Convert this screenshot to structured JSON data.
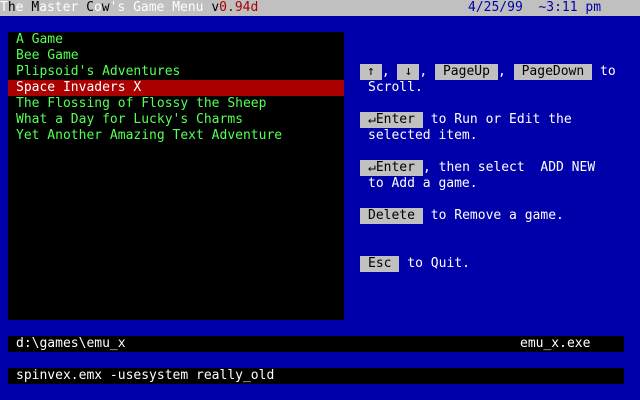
{
  "titlebar": {
    "title_parts": [
      "T",
      "h",
      "e ",
      "M",
      "aster ",
      "C",
      "o",
      "w",
      "'s Game Menu ",
      "v",
      "0.94d"
    ],
    "datetime": "4/25/99  ~3:11 pm"
  },
  "game_list": {
    "items": [
      "A Game",
      "Bee Game",
      "Plipsoid's Adventures",
      "Space Invaders X",
      "The Flossing of Flossy the Sheep",
      "What a Day for Lucky's Charms",
      "Yet Another Amazing Text Adventure"
    ],
    "selected_index": 3
  },
  "help": {
    "scroll": {
      "key_up": "↑",
      "key_down": "↓",
      "key_pageup": "PageUp",
      "key_pagedown": "PageDown",
      "sep1": ", ",
      "sep2": ", ",
      "sep3": ", ",
      "text_to": " to",
      "text_line2": "Scroll."
    },
    "run": {
      "key": "↵Enter",
      "text_line1": " to Run or Edit the",
      "text_line2": "selected item."
    },
    "add": {
      "key": "↵Enter",
      "text_line1": ", then select  ADD NEW",
      "text_line2": "to Add a game."
    },
    "delete": {
      "key": "Delete",
      "text": " to Remove a game."
    },
    "quit": {
      "key": "Esc",
      "text": " to Quit."
    }
  },
  "fields": {
    "directory": "d:\\games\\emu_x",
    "executable": "emu_x.exe",
    "arguments": "spinvex.emx -usesystem really_old"
  },
  "colors": {
    "background": "#0000aa",
    "list_text": "#55ff55",
    "selected_bg": "#aa0000",
    "titlebar_bg": "#c0c0c0"
  }
}
